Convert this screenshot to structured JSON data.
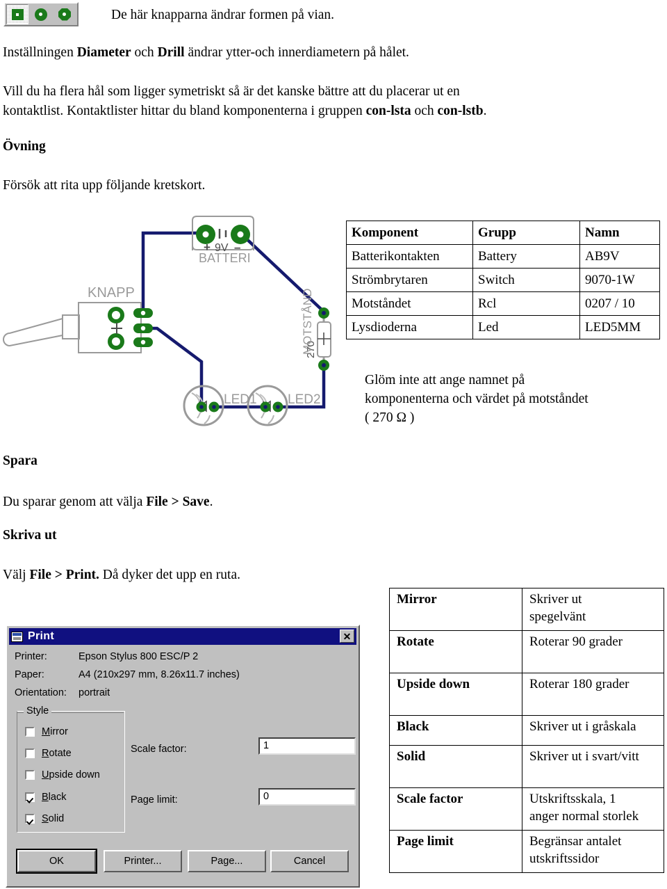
{
  "toolbar": {
    "buttons": [
      {
        "name": "square-pad",
        "shape": "square",
        "pressed": true
      },
      {
        "name": "round-pad",
        "shape": "circle",
        "pressed": false
      },
      {
        "name": "octagon-pad",
        "shape": "octagon",
        "pressed": false
      }
    ],
    "caption": "De här knapparna ändrar formen på vian.",
    "pad_color": "#1a7a1a",
    "hole_color": "#ffffff"
  },
  "body": {
    "para1_a": "Inställningen ",
    "para1_b": "Diameter",
    "para1_c": " och ",
    "para1_d": "Drill",
    "para1_e": " ändrar ytter-och innerdiametern på hålet.",
    "para2_line1": "Vill du ha flera hål som ligger symetriskt så är det kanske bättre att du placerar ut en",
    "para2_line2_a": "kontaktlist. Kontaktlister hittar du bland komponenterna i gruppen ",
    "para2_line2_b": "con-lsta",
    "para2_line2_c": " och ",
    "para2_line2_d": "con-lstb",
    "para2_line2_e": ".",
    "heading_ovning": "Övning",
    "ovning_text": "Försök att rita upp följande kretskort.",
    "heading_spara": "Spara",
    "spara_a": "Du sparar genom att välja ",
    "spara_b": "File > Save",
    "spara_c": ".",
    "heading_skriva_ut": "Skriva ut",
    "skriva_a": "Välj ",
    "skriva_b": "File > Print.",
    "skriva_c": " Då dyker det upp en ruta."
  },
  "component_table": {
    "headers": [
      "Komponent",
      "Grupp",
      "Namn"
    ],
    "rows": [
      [
        "Batterikontakten",
        "Battery",
        "AB9V"
      ],
      [
        "Strömbrytaren",
        "Switch",
        "9070-1W"
      ],
      [
        "Motståndet",
        "Rcl",
        "0207 / 10"
      ],
      [
        "Lysdioderna",
        "Led",
        "LED5MM"
      ]
    ]
  },
  "table_note": {
    "line1": "Glöm inte att ange namnet på",
    "line2": "komponenterna och värdet på motståndet",
    "line3": "( 270 Ω )"
  },
  "circuit": {
    "labels": {
      "switch": "KNAPP",
      "battery": "BATTERI",
      "battery_voltage": "9V",
      "battery_plus": "+",
      "battery_minus": "–",
      "resistor": "MOTSTÅND",
      "resistor_value": "270",
      "led1": "LED1",
      "led2": "LED2",
      "switch_plus": "+"
    },
    "colors": {
      "wire": "#151a6e",
      "pad": "#1a7a1a",
      "outline": "#9a9a9a"
    }
  },
  "print_dialog": {
    "title": "Print",
    "close_label": "✕",
    "printer_label": "Printer:",
    "printer_value": "Epson Stylus 800 ESC/P 2",
    "paper_label": "Paper:",
    "paper_value": "A4 (210x297 mm, 8.26x11.7 inches)",
    "orientation_label": "Orientation:",
    "orientation_value": "portrait",
    "style_legend": "Style",
    "checkboxes": [
      {
        "label": "Mirror",
        "mnemonic": "M",
        "checked": false
      },
      {
        "label": "Rotate",
        "mnemonic": "R",
        "checked": false
      },
      {
        "label": "Upside down",
        "mnemonic": "U",
        "checked": false
      },
      {
        "label": "Black",
        "mnemonic": "B",
        "checked": true
      },
      {
        "label": "Solid",
        "mnemonic": "S",
        "checked": true
      }
    ],
    "scale_factor_label": "Scale factor:",
    "scale_factor_value": "1",
    "page_limit_label": "Page limit:",
    "page_limit_value": "0",
    "buttons": [
      {
        "label": "OK",
        "default": true
      },
      {
        "label": "Printer...",
        "default": false
      },
      {
        "label": "Page...",
        "default": false
      },
      {
        "label": "Cancel",
        "default": false
      }
    ]
  },
  "print_option_table": {
    "rows": [
      {
        "key": "Mirror",
        "desc": "Skriver ut\nspegelvänt"
      },
      {
        "key": "Rotate",
        "desc": "Roterar 90 grader"
      },
      {
        "key": "Upside down",
        "desc": "Roterar 180 grader"
      },
      {
        "key": "Black",
        "desc": "Skriver ut i gråskala"
      },
      {
        "key": "Solid",
        "desc": "Skriver ut i svart/vitt"
      },
      {
        "key": "Scale factor",
        "desc": "Utskriftsskala, 1\nanger normal storlek"
      },
      {
        "key": "Page limit",
        "desc": "Begränsar antalet\nutskriftssidor"
      }
    ]
  }
}
